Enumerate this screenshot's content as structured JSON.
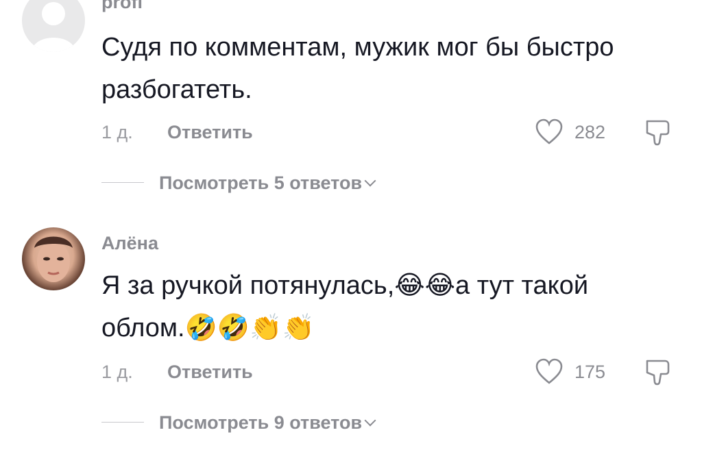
{
  "comments": [
    {
      "username": "profi",
      "text": "Судя по комментам, мужик мог бы быстро разбогатеть.",
      "time": "1 д.",
      "reply_label": "Ответить",
      "likes": "282",
      "view_replies": "Посмотреть 5 ответов",
      "avatar": "default-avatar"
    },
    {
      "username": "Алёна",
      "text_line1": "Я за ручкой потянулась,😂😂а тут такой",
      "text_line2": "облом.🤣🤣👏👏",
      "time": "1 д.",
      "reply_label": "Ответить",
      "likes": "175",
      "view_replies": "Посмотреть 9 ответов",
      "avatar": "user-photo"
    }
  ],
  "icons": {
    "like": "heart-outline-icon",
    "dislike": "thumbs-down-icon",
    "expand": "chevron-down-icon"
  },
  "colors": {
    "text": "#161823",
    "secondary": "#8a8b91"
  }
}
